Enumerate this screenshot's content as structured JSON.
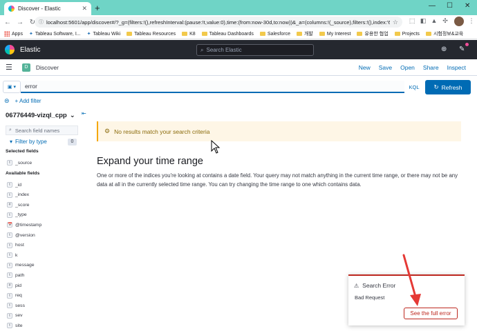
{
  "browser": {
    "tab_title": "Discover - Elastic",
    "url": "localhost:5601/app/discover#/?_g=(filters:!(),refreshInterval:(pause:!t,value:0),time:(from:now-30d,to:now))&_a=(columns:!(_source),filters:!(),index:'64...",
    "bookmarks": [
      "Apps",
      "Tableau Software, I...",
      "Tableau Wiki",
      "Tableau Resources",
      "K8",
      "Tableau Dashboards",
      "Salesforce",
      "개발",
      "My Interest",
      "유용한 협업",
      "Projects",
      "시험정보&교육"
    ]
  },
  "kibana": {
    "app_name": "Elastic",
    "search_placeholder": "Search Elastic",
    "space_badge": "D",
    "breadcrumb": "Discover",
    "top_nav": [
      "New",
      "Save",
      "Open",
      "Share",
      "Inspect"
    ]
  },
  "query": {
    "value": "error",
    "language": "KQL",
    "refresh_label": "Refresh",
    "add_filter": "+ Add filter"
  },
  "sidebar": {
    "index_pattern": "06776449-vizql_cpp",
    "field_search_placeholder": "Search field names",
    "filter_by_type": "Filter by type",
    "filter_count": "0",
    "selected_heading": "Selected fields",
    "selected_fields": [
      {
        "type": "t",
        "name": "_source"
      }
    ],
    "available_heading": "Available fields",
    "available_fields": [
      {
        "type": "t",
        "name": "_id"
      },
      {
        "type": "t",
        "name": "_index"
      },
      {
        "type": "#",
        "name": "_score"
      },
      {
        "type": "t",
        "name": "_type"
      },
      {
        "type": "📅",
        "name": "@timestamp"
      },
      {
        "type": "t",
        "name": "@version"
      },
      {
        "type": "t",
        "name": "host"
      },
      {
        "type": "t",
        "name": "k"
      },
      {
        "type": "t",
        "name": "message"
      },
      {
        "type": "t",
        "name": "path"
      },
      {
        "type": "#",
        "name": "pid"
      },
      {
        "type": "t",
        "name": "req"
      },
      {
        "type": "t",
        "name": "sess"
      },
      {
        "type": "t",
        "name": "sev"
      },
      {
        "type": "t",
        "name": "site"
      }
    ]
  },
  "main": {
    "no_results": "No results match your search criteria",
    "heading": "Expand your time range",
    "description": "One or more of the indices you're looking at contains a date field. Your query may not match anything in the current time range, or there may not be any data at all in the currently selected time range. You can try changing the time range to one which contains data."
  },
  "toast": {
    "title": "Search Error",
    "body": "Bad Request",
    "button": "See the full error"
  },
  "colors": {
    "accent": "#006bb4",
    "danger": "#bd271e",
    "warning_bg": "#fef6e6",
    "header_bg": "#25282f",
    "chrome_tab_strip": "#6fd4c6"
  }
}
